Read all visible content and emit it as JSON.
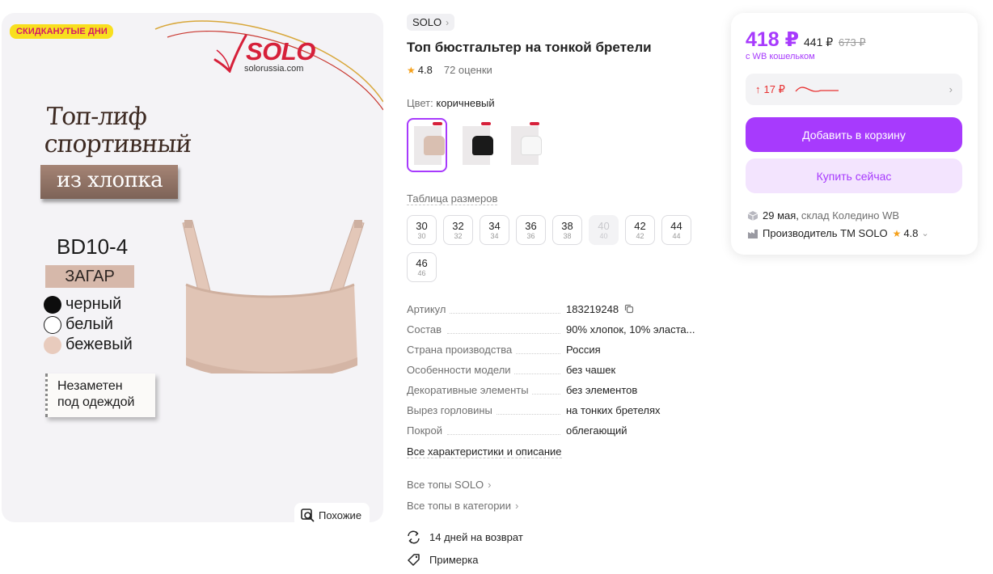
{
  "gallery": {
    "promo_badge": "СКИДКАНУТЫЕ ДНИ",
    "logo_word": "SOLO",
    "logo_url": "solorussia.com",
    "title_line1": "Топ-лиф",
    "title_line2": "спортивный",
    "ribbon_text": "из хлопка",
    "model": "BD10-4",
    "tone_tag": "ЗАГАР",
    "colors": [
      "черный",
      "белый",
      "бежевый"
    ],
    "invisible_line1": "Незаметен",
    "invisible_line2": "под одеждой",
    "similar_button": "Похожие",
    "similar_icon": "search-similar-icon"
  },
  "product": {
    "brand": "SOLO",
    "title": "Топ бюстгальтер на тонкой бретели",
    "rating": "4.8",
    "reviews": "72 оценки",
    "color_label": "Цвет:",
    "color_value": "коричневый",
    "swatch_colors": [
      "#d9bfb1",
      "#1a1a1a",
      "#f7f7f7"
    ],
    "sizes_link": "Таблица размеров",
    "sizes": [
      {
        "size": "30",
        "ru": "30",
        "available": true
      },
      {
        "size": "32",
        "ru": "32",
        "available": true
      },
      {
        "size": "34",
        "ru": "34",
        "available": true
      },
      {
        "size": "36",
        "ru": "36",
        "available": true
      },
      {
        "size": "38",
        "ru": "38",
        "available": true
      },
      {
        "size": "40",
        "ru": "40",
        "available": false
      },
      {
        "size": "42",
        "ru": "42",
        "available": true
      },
      {
        "size": "44",
        "ru": "44",
        "available": true
      },
      {
        "size": "46",
        "ru": "46",
        "available": true
      }
    ],
    "specs": [
      {
        "key": "Артикул",
        "value": "183219248"
      },
      {
        "key": "Состав",
        "value": "90% хлопок, 10% эласта..."
      },
      {
        "key": "Страна производства",
        "value": "Россия"
      },
      {
        "key": "Особенности модели",
        "value": "без чашек"
      },
      {
        "key": "Декоративные элементы",
        "value": "без элементов"
      },
      {
        "key": "Вырез горловины",
        "value": "на тонких бретелях"
      },
      {
        "key": "Покрой",
        "value": "облегающий"
      }
    ],
    "all_specs_link": "Все характеристики и описание",
    "brand_tops_link": "Все топы SOLO",
    "category_tops_link": "Все топы в категории",
    "return_policy": "14 дней на возврат",
    "fitting": "Примерка"
  },
  "buy": {
    "price": "418 ₽",
    "price_mid": "441 ₽",
    "price_old": "673 ₽",
    "wallet_note": "с WB кошельком",
    "price_change": "17 ₽",
    "add_to_cart": "Добавить в корзину",
    "buy_now": "Купить сейчас",
    "delivery_date": "29 мая,",
    "delivery_warehouse": "склад Коледино WB",
    "manufacturer": "Производитель ТМ SOLO",
    "manufacturer_rating": "4.8",
    "accent_color": "#a73afd"
  }
}
